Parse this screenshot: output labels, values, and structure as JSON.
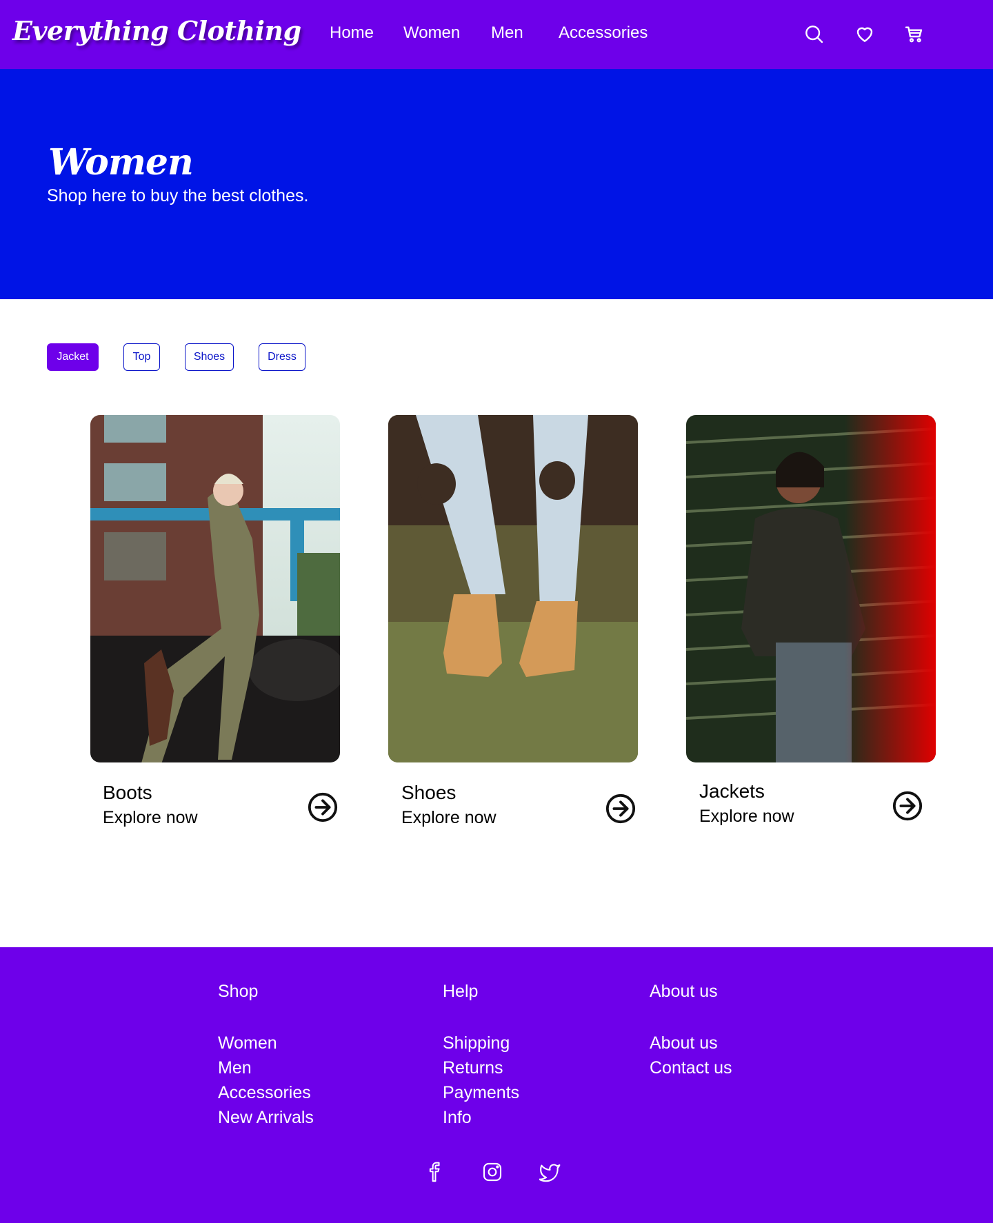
{
  "header": {
    "logo": "Everything Clothing",
    "nav": [
      "Home",
      "Women",
      "Men",
      "Accessories"
    ],
    "icons": [
      "search-icon",
      "heart-icon",
      "cart-icon"
    ]
  },
  "hero": {
    "title": "Women",
    "subtitle": "Shop here to buy the best clothes."
  },
  "filters": {
    "active": "Jacket",
    "items": [
      "Jacket",
      "Top",
      "Shoes",
      "Dress"
    ]
  },
  "products": [
    {
      "title": "Boots",
      "link": "Explore now"
    },
    {
      "title": "Shoes",
      "link": "Explore now"
    },
    {
      "title": "Jackets",
      "link": "Explore now"
    }
  ],
  "footer": {
    "shop": {
      "heading": "Shop",
      "items": [
        "Women",
        "Men",
        "Accessories",
        "New Arrivals"
      ]
    },
    "help": {
      "heading": "Help",
      "items": [
        "Shipping",
        "Returns",
        "Payments",
        "Info"
      ]
    },
    "about": {
      "heading": "About us",
      "items": [
        "About us",
        "Contact us"
      ]
    },
    "social": [
      "facebook-icon",
      "instagram-icon",
      "twitter-icon"
    ]
  },
  "colors": {
    "primary": "#6e00ea",
    "hero": "#0014e6",
    "chip_border": "#0a14c8"
  }
}
